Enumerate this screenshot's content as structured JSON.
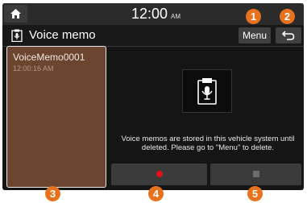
{
  "status_bar": {
    "time": "12:00",
    "ampm": "AM"
  },
  "title_bar": {
    "title": "Voice memo",
    "menu_label": "Menu",
    "title_icon": "voice-memo-icon",
    "back_icon": "back-arrow-icon"
  },
  "memo_list": {
    "items": [
      {
        "name": "VoiceMemo0001",
        "time": "12:00:16 AM"
      }
    ]
  },
  "main": {
    "info_message": "Voice memos are stored in this vehicle system until deleted. Please go to \"Menu\" to delete.",
    "record_icon": "record-icon",
    "stop_icon": "stop-icon"
  },
  "callouts": [
    "1",
    "2",
    "3",
    "4",
    "5"
  ],
  "colors": {
    "accent": "#e8711d",
    "record": "#e2101b",
    "list_bg": "#6b4530"
  }
}
